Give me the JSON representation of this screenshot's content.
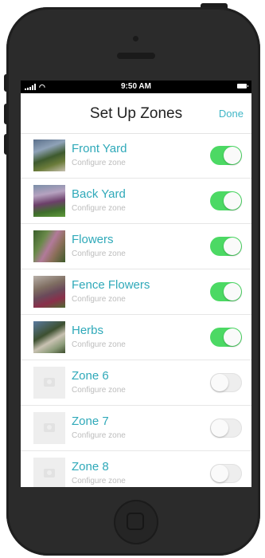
{
  "status_bar": {
    "time": "9:50 AM"
  },
  "navbar": {
    "title": "Set Up Zones",
    "done_label": "Done"
  },
  "zones": [
    {
      "name": "Front Yard",
      "subtitle": "Configure zone",
      "enabled": true,
      "thumbnail": "photo-front-yard"
    },
    {
      "name": "Back Yard",
      "subtitle": "Configure zone",
      "enabled": true,
      "thumbnail": "photo-back-yard"
    },
    {
      "name": "Flowers",
      "subtitle": "Configure zone",
      "enabled": true,
      "thumbnail": "photo-flowers"
    },
    {
      "name": "Fence Flowers",
      "subtitle": "Configure zone",
      "enabled": true,
      "thumbnail": "photo-fence-flowers"
    },
    {
      "name": "Herbs",
      "subtitle": "Configure zone",
      "enabled": true,
      "thumbnail": "photo-herbs"
    },
    {
      "name": "Zone 6",
      "subtitle": "Configure zone",
      "enabled": false,
      "thumbnail": "camera-icon"
    },
    {
      "name": "Zone 7",
      "subtitle": "Configure zone",
      "enabled": false,
      "thumbnail": "camera-icon"
    },
    {
      "name": "Zone 8",
      "subtitle": "Configure zone",
      "enabled": false,
      "thumbnail": "camera-icon"
    }
  ],
  "colors": {
    "accent": "#2fa9b9",
    "toggle_on": "#4cd964",
    "toggle_off": "#eeeeee"
  }
}
